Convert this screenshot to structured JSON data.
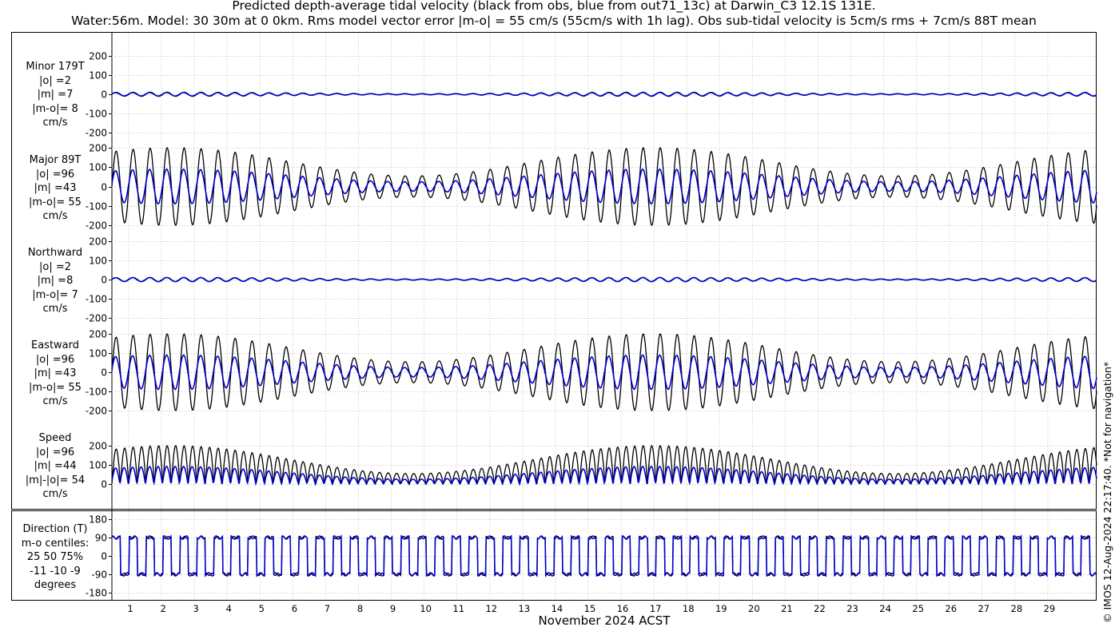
{
  "title": {
    "line1": "Predicted depth-average tidal velocity (black from obs, blue from out71_13c) at Darwin_C3 12.1S 131E.",
    "line2": "Water:56m. Model: 30 30m at 0 0km. Rms model vector error |m-o| = 55 cm/s (55cm/s with 1h lag). Obs sub-tidal velocity is 5cm/s rms + 7cm/s 88T mean"
  },
  "copyright": "© IMOS 12-Aug-2024 22:17:40. *Not for navigation*",
  "colors": {
    "obs": "#000000",
    "model": "#0000cc",
    "grid": "#c8c8c8"
  },
  "chart_data": {
    "type": "line",
    "xlabel": "November 2024 ACST",
    "x_ticks": [
      "1",
      "2",
      "3",
      "4",
      "5",
      "6",
      "7",
      "8",
      "9",
      "10",
      "11",
      "12",
      "13",
      "14",
      "15",
      "16",
      "17",
      "18",
      "19",
      "20",
      "21",
      "22",
      "23",
      "24",
      "25",
      "26",
      "27",
      "28",
      "29"
    ],
    "xlim": [
      0,
      30
    ],
    "grid": "dotted",
    "series_colors": {
      "obs": "black",
      "model": "blue"
    },
    "panels": [
      {
        "key": "minor",
        "label": [
          "Minor 179T",
          "|o| =2",
          "|m| =7",
          "|m-o|= 8",
          "cm/s"
        ],
        "ylim": [
          -200,
          200
        ],
        "yticks": [
          "200",
          "100",
          "0",
          "-100",
          "-200"
        ],
        "obs_amplitude": 2,
        "model_amplitude": 7
      },
      {
        "key": "major",
        "label": [
          "Major 89T",
          "|o| =96",
          "|m| =43",
          "|m-o|= 55",
          "cm/s"
        ],
        "ylim": [
          -200,
          200
        ],
        "yticks": [
          "200",
          "100",
          "0",
          "-100",
          "-200"
        ],
        "obs_amplitude": 96,
        "model_amplitude": 43
      },
      {
        "key": "north",
        "label": [
          "Northward",
          "|o| =2",
          "|m| =8",
          "|m-o|= 7",
          "cm/s"
        ],
        "ylim": [
          -200,
          200
        ],
        "yticks": [
          "200",
          "100",
          "0",
          "-100",
          "-200"
        ],
        "obs_amplitude": 2,
        "model_amplitude": 8
      },
      {
        "key": "east",
        "label": [
          "Eastward",
          "|o| =96",
          "|m| =43",
          "|m-o|= 55",
          "cm/s"
        ],
        "ylim": [
          -200,
          200
        ],
        "yticks": [
          "200",
          "100",
          "0",
          "-100",
          "-200"
        ],
        "obs_amplitude": 96,
        "model_amplitude": 43
      },
      {
        "key": "speed",
        "label": [
          "Speed",
          "|o| =96",
          "|m| =44",
          "|m|-|o|= 54",
          "cm/s"
        ],
        "ylim": [
          0,
          200
        ],
        "yticks": [
          "200",
          "100",
          "0"
        ],
        "obs_amplitude": 96,
        "model_amplitude": 44
      },
      {
        "key": "direction",
        "label": [
          "Direction (T)",
          "m-o centiles:",
          "25  50  75%",
          "-11 -10  -9",
          "degrees"
        ],
        "ylim": [
          -180,
          180
        ],
        "yticks": [
          "180",
          "90",
          "0",
          "-90",
          "-180"
        ]
      }
    ]
  }
}
